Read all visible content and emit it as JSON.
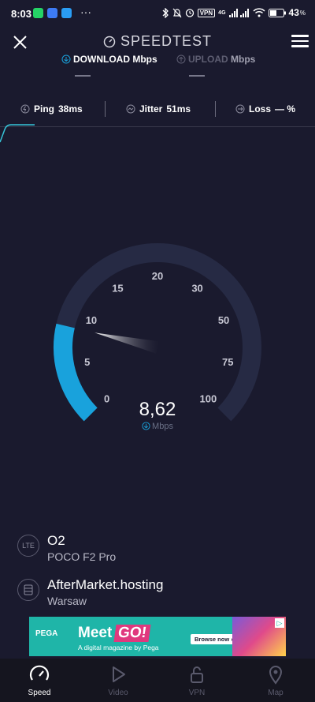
{
  "status_bar": {
    "time": "8:03",
    "more": "···",
    "battery": "43",
    "icons": [
      "whatsapp-icon",
      "home-app-icon",
      "app-icon",
      "bluetooth-icon",
      "bell-off-icon",
      "alarm-icon",
      "vpn-icon",
      "signal-icon",
      "wifi-icon",
      "battery-icon"
    ],
    "vpn_label": "VPN",
    "net_label": "4G"
  },
  "header": {
    "title": "SPEEDTEST",
    "download_label": "DOWNLOAD",
    "download_unit": "Mbps",
    "upload_label": "UPLOAD",
    "upload_unit": "Mbps"
  },
  "metrics": {
    "ping_label": "Ping",
    "ping_value": "38ms",
    "jitter_label": "Jitter",
    "jitter_value": "51ms",
    "loss_label": "Loss",
    "loss_value": "— %"
  },
  "gauge": {
    "ticks": [
      "0",
      "5",
      "10",
      "15",
      "20",
      "30",
      "50",
      "75",
      "100"
    ],
    "reading": "8,62",
    "reading_value": 8.62,
    "unit": "Mbps",
    "accent_color": "#19a2dc",
    "track_color": "#262a44"
  },
  "provider": {
    "icon_label": "LTE",
    "name": "O2",
    "device": "POCO F2 Pro"
  },
  "server": {
    "name": "AfterMarket.hosting",
    "location": "Warsaw"
  },
  "ad": {
    "brand": "PEGA",
    "headline": "Meet",
    "headline_accent": "GO!",
    "subline": "A digital magazine by Pega",
    "cta": "Browse now ›",
    "adchoice": "▷"
  },
  "nav": [
    {
      "label": "Speed",
      "active": true
    },
    {
      "label": "Video",
      "active": false
    },
    {
      "label": "VPN",
      "active": false
    },
    {
      "label": "Map",
      "active": false
    }
  ]
}
